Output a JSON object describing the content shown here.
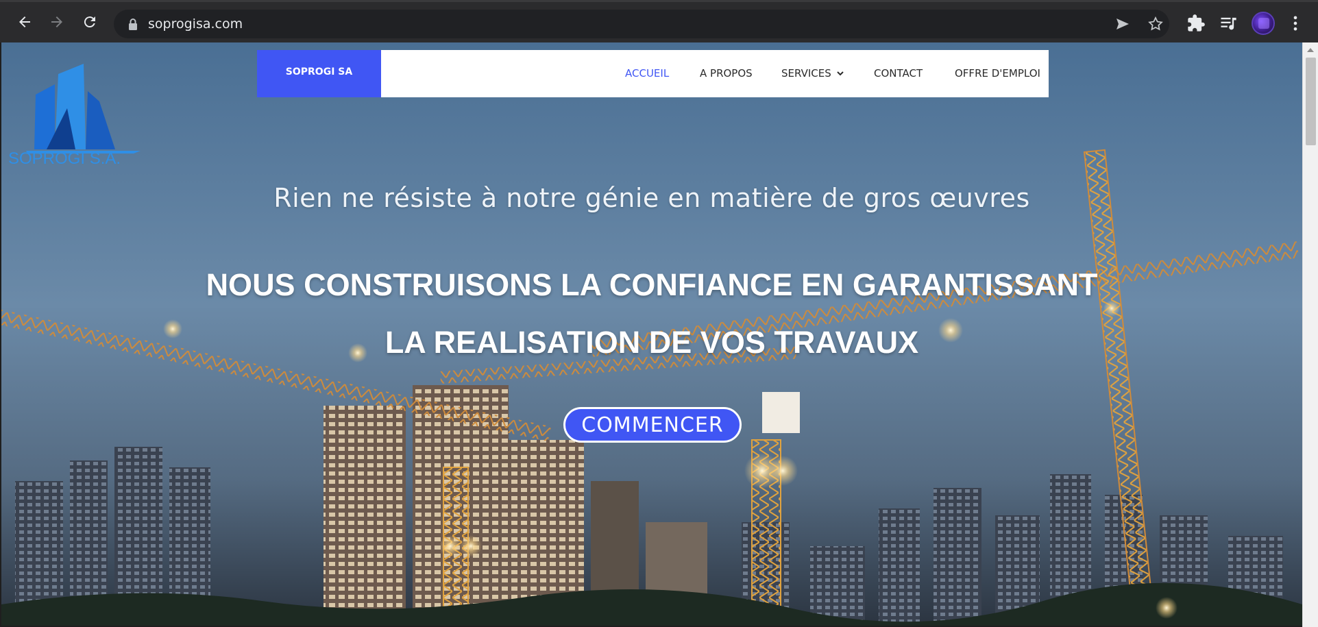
{
  "browser": {
    "url": "soprogisa.com"
  },
  "site": {
    "logo_text": "SOPROGI S.A.",
    "brand": "SOPROGI SA",
    "menu": [
      {
        "label": "ACCUEIL",
        "active": true
      },
      {
        "label": "A PROPOS",
        "active": false
      },
      {
        "label": "SERVICES",
        "active": false,
        "has_dropdown": true
      },
      {
        "label": "CONTACT",
        "active": false
      },
      {
        "label": "OFFRE D'EMPLOI",
        "active": false
      }
    ]
  },
  "hero": {
    "tagline": "Rien ne résiste à notre génie en matière de gros œuvres",
    "headline_line1": "NOUS CONSTRUISONS LA CONFIANCE EN GARANTISSANT",
    "headline_line2": "LA REALISATION DE VOS TRAVAUX",
    "cta_label": "COMMENCER"
  },
  "colors": {
    "accent": "#4056f4",
    "logo_blue": "#2f8fe6",
    "chrome_bg": "#2b2b2d"
  }
}
